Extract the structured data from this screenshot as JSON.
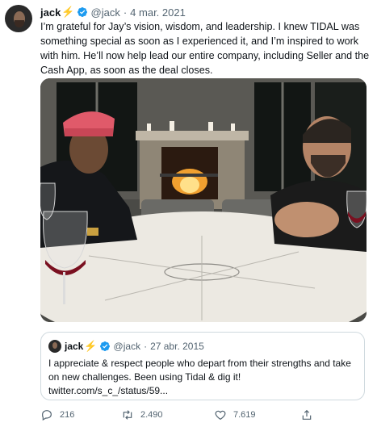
{
  "tweet": {
    "author_name": "jack",
    "author_emoji": "⚡",
    "handle": "@jack",
    "separator": "·",
    "date": "4 mar. 2021",
    "text": "I’m grateful for Jay’s vision, wisdom, and leadership. I knew TIDAL was something special as soon as I experienced it, and I’m inspired to work with him. He’ll now help lead our entire company, including Seller and the Cash App, as soon as the deal closes."
  },
  "quoted_tweet": {
    "author_name": "jack",
    "author_emoji": "⚡",
    "handle": "@jack",
    "separator": "·",
    "date": "27 abr. 2015",
    "text_line1": "I appreciate & respect people who depart from their strengths and take on new challenges. Been using Tidal & dig it!",
    "link": "twitter.com/s_c_/status/59..."
  },
  "actions": {
    "replies": "216",
    "retweets": "2.490",
    "likes": "7.619"
  },
  "colors": {
    "verified": "#1d9bf0",
    "secondary_text": "#536471",
    "border": "#cfd9de"
  },
  "icons": [
    "verified-badge-icon",
    "reply-icon",
    "retweet-icon",
    "like-icon",
    "share-icon"
  ]
}
